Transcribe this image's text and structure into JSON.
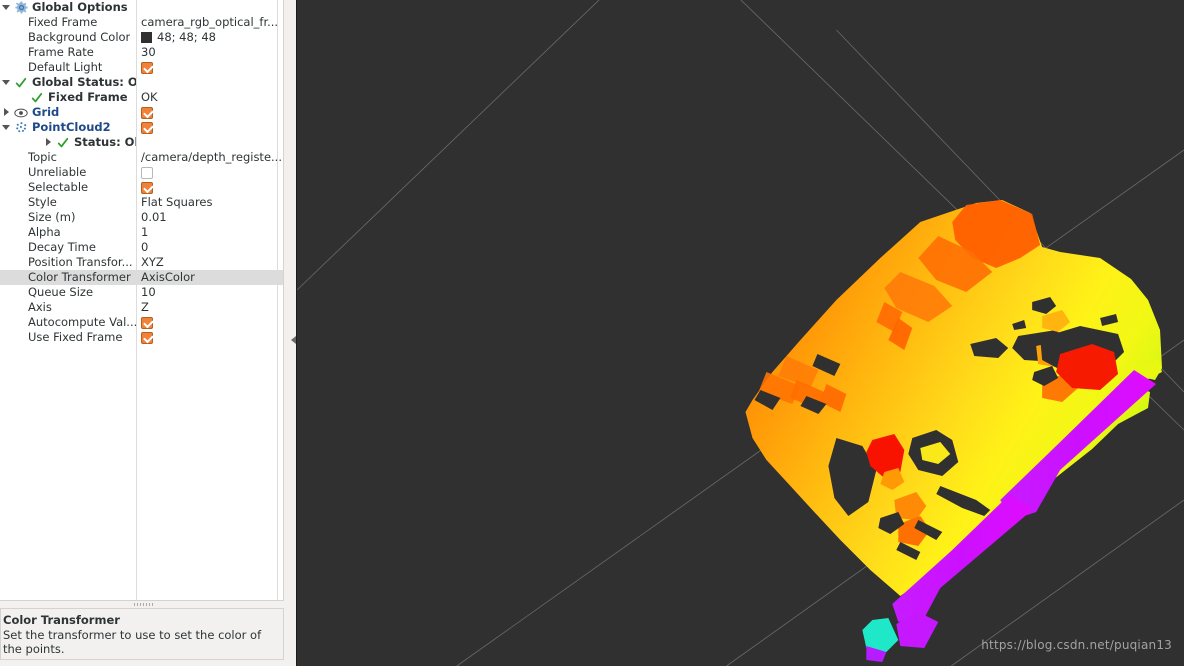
{
  "app": {
    "name": "RViz",
    "background_color_hex": "#303030",
    "panel_bg_hex": "#f2f1f0",
    "accent_hex": "#f0823c",
    "link_hex": "#204a87"
  },
  "displays_tree": {
    "rows": [
      {
        "id": "global-options",
        "indent": 0,
        "expander": "down",
        "icon": "gear-icon",
        "label": "Global Options",
        "label_style": "bold",
        "value_type": "none",
        "value": ""
      },
      {
        "id": "fixed-frame",
        "indent": 1,
        "expander": "none",
        "icon": "none",
        "label": "Fixed Frame",
        "label_style": "normal",
        "value_type": "text",
        "value": "camera_rgb_optical_fr..."
      },
      {
        "id": "background-color",
        "indent": 1,
        "expander": "none",
        "icon": "none",
        "label": "Background Color",
        "label_style": "normal",
        "value_type": "color",
        "value": "48; 48; 48",
        "swatch_hex": "#303030"
      },
      {
        "id": "frame-rate",
        "indent": 1,
        "expander": "none",
        "icon": "none",
        "label": "Frame Rate",
        "label_style": "normal",
        "value_type": "text",
        "value": "30"
      },
      {
        "id": "default-light",
        "indent": 1,
        "expander": "none",
        "icon": "none",
        "label": "Default Light",
        "label_style": "normal",
        "value_type": "checkbox",
        "checked": true,
        "value": ""
      },
      {
        "id": "global-status",
        "indent": 0,
        "expander": "down",
        "icon": "check-icon",
        "label": "Global Status: Ok",
        "label_style": "bold",
        "value_type": "none",
        "value": ""
      },
      {
        "id": "global-status-fixed-frame",
        "indent": 2,
        "expander": "none",
        "icon": "check-icon",
        "label": "Fixed Frame",
        "label_style": "bold",
        "value_type": "text",
        "value": "OK"
      },
      {
        "id": "grid",
        "indent": 0,
        "expander": "right",
        "icon": "eye-icon",
        "label": "Grid",
        "label_style": "link",
        "value_type": "checkbox",
        "checked": true,
        "value": ""
      },
      {
        "id": "pointcloud2",
        "indent": 0,
        "expander": "down",
        "icon": "pointcloud-icon",
        "label": "PointCloud2",
        "label_style": "link",
        "value_type": "checkbox",
        "checked": true,
        "value": ""
      },
      {
        "id": "pointcloud2-status",
        "indent": 3,
        "expander": "right",
        "icon": "check-icon",
        "label": "Status: Ok",
        "label_style": "bold",
        "value_type": "none",
        "value": ""
      },
      {
        "id": "topic",
        "indent": 1,
        "expander": "none",
        "icon": "none",
        "label": "Topic",
        "label_style": "normal",
        "value_type": "text",
        "value": "/camera/depth_registe..."
      },
      {
        "id": "unreliable",
        "indent": 1,
        "expander": "none",
        "icon": "none",
        "label": "Unreliable",
        "label_style": "normal",
        "value_type": "checkbox",
        "checked": false,
        "value": ""
      },
      {
        "id": "selectable",
        "indent": 1,
        "expander": "none",
        "icon": "none",
        "label": "Selectable",
        "label_style": "normal",
        "value_type": "checkbox",
        "checked": true,
        "value": ""
      },
      {
        "id": "style",
        "indent": 1,
        "expander": "none",
        "icon": "none",
        "label": "Style",
        "label_style": "normal",
        "value_type": "text",
        "value": "Flat Squares"
      },
      {
        "id": "size-m",
        "indent": 1,
        "expander": "none",
        "icon": "none",
        "label": "Size (m)",
        "label_style": "normal",
        "value_type": "text",
        "value": "0.01"
      },
      {
        "id": "alpha",
        "indent": 1,
        "expander": "none",
        "icon": "none",
        "label": "Alpha",
        "label_style": "normal",
        "value_type": "text",
        "value": "1"
      },
      {
        "id": "decay-time",
        "indent": 1,
        "expander": "none",
        "icon": "none",
        "label": "Decay Time",
        "label_style": "normal",
        "value_type": "text",
        "value": "0"
      },
      {
        "id": "position-transformer",
        "indent": 1,
        "expander": "none",
        "icon": "none",
        "label": "Position Transfor...",
        "label_style": "normal",
        "value_type": "text",
        "value": "XYZ"
      },
      {
        "id": "color-transformer",
        "indent": 1,
        "expander": "none",
        "icon": "none",
        "label": "Color Transformer",
        "label_style": "normal",
        "value_type": "text",
        "value": "AxisColor",
        "selected": true
      },
      {
        "id": "queue-size",
        "indent": 1,
        "expander": "none",
        "icon": "none",
        "label": "Queue Size",
        "label_style": "normal",
        "value_type": "text",
        "value": "10"
      },
      {
        "id": "axis",
        "indent": 1,
        "expander": "none",
        "icon": "none",
        "label": "Axis",
        "label_style": "normal",
        "value_type": "text",
        "value": "Z"
      },
      {
        "id": "autocompute-value",
        "indent": 1,
        "expander": "none",
        "icon": "none",
        "label": "Autocompute Val...",
        "label_style": "normal",
        "value_type": "checkbox",
        "checked": true,
        "value": ""
      },
      {
        "id": "use-fixed-frame",
        "indent": 1,
        "expander": "none",
        "icon": "none",
        "label": "Use Fixed Frame",
        "label_style": "normal",
        "value_type": "checkbox",
        "checked": true,
        "value": ""
      }
    ]
  },
  "help": {
    "title": "Color Transformer",
    "body": "Set the transformer to use to set the color of the points."
  },
  "viewport": {
    "watermark": "https://blog.csdn.net/puqian13"
  }
}
